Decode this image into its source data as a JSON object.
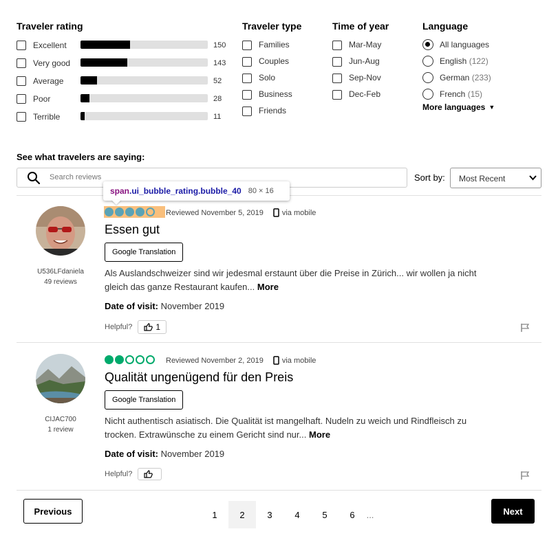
{
  "filters": {
    "rating": {
      "heading": "Traveler rating",
      "items": [
        {
          "label": "Excellent",
          "count": "150",
          "fraction": 0.39
        },
        {
          "label": "Very good",
          "count": "143",
          "fraction": 0.37
        },
        {
          "label": "Average",
          "count": "52",
          "fraction": 0.13
        },
        {
          "label": "Poor",
          "count": "28",
          "fraction": 0.07
        },
        {
          "label": "Terrible",
          "count": "11",
          "fraction": 0.03
        }
      ]
    },
    "type": {
      "heading": "Traveler type",
      "items": [
        "Families",
        "Couples",
        "Solo",
        "Business",
        "Friends"
      ]
    },
    "time": {
      "heading": "Time of year",
      "items": [
        "Mar-May",
        "Jun-Aug",
        "Sep-Nov",
        "Dec-Feb"
      ]
    },
    "language": {
      "heading": "Language",
      "items": [
        {
          "label": "All languages",
          "count": ""
        },
        {
          "label": "English",
          "count": "(122)"
        },
        {
          "label": "German",
          "count": "(233)"
        },
        {
          "label": "French",
          "count": "(15)"
        }
      ],
      "more": "More languages"
    }
  },
  "reviews_section": {
    "heading": "See what travelers are saying:",
    "search_placeholder": "Search reviews",
    "sort_label": "Sort by:",
    "sort_value": "Most Recent"
  },
  "tooltip": {
    "tag": "span",
    "classes": ".ui_bubble_rating.bubble_40",
    "size": "80 × 16"
  },
  "reviews": [
    {
      "username": "U536LFdaniela",
      "review_count": "49 reviews",
      "rating": 4,
      "reviewed": "Reviewed November 5, 2019",
      "via": "via mobile",
      "title": "Essen gut",
      "translate": "Google Translation",
      "text": "Als Auslandschweizer sind wir jedesmal erstaunt über die Preise in Zürich... wir wollen ja nicht gleich das ganze Restaurant kaufen...",
      "more": "More",
      "visit_label": "Date of visit:",
      "visit_date": "November 2019",
      "helpful_label": "Helpful?",
      "helpful_count": "1"
    },
    {
      "username": "CIJAC700",
      "review_count": "1 review",
      "rating": 2,
      "reviewed": "Reviewed November 2, 2019",
      "via": "via mobile",
      "title": "Qualität ungenügend für den Preis",
      "translate": "Google Translation",
      "text": "Nicht authentisch asiatisch. Die Qualität ist mangelhaft. Nudeln zu weich und Rindfleisch zu trocken. Extrawünsche zu einem Gericht sind nur...",
      "more": "More",
      "visit_label": "Date of visit:",
      "visit_date": "November 2019",
      "helpful_label": "Helpful?",
      "helpful_count": ""
    }
  ],
  "pagination": {
    "prev": "Previous",
    "next": "Next",
    "pages": [
      "1",
      "2",
      "3",
      "4",
      "5",
      "6"
    ],
    "active": "2",
    "ellipsis": "..."
  },
  "colors": {
    "bubble": "#00aa6c",
    "highlight": "#f7aa50"
  }
}
